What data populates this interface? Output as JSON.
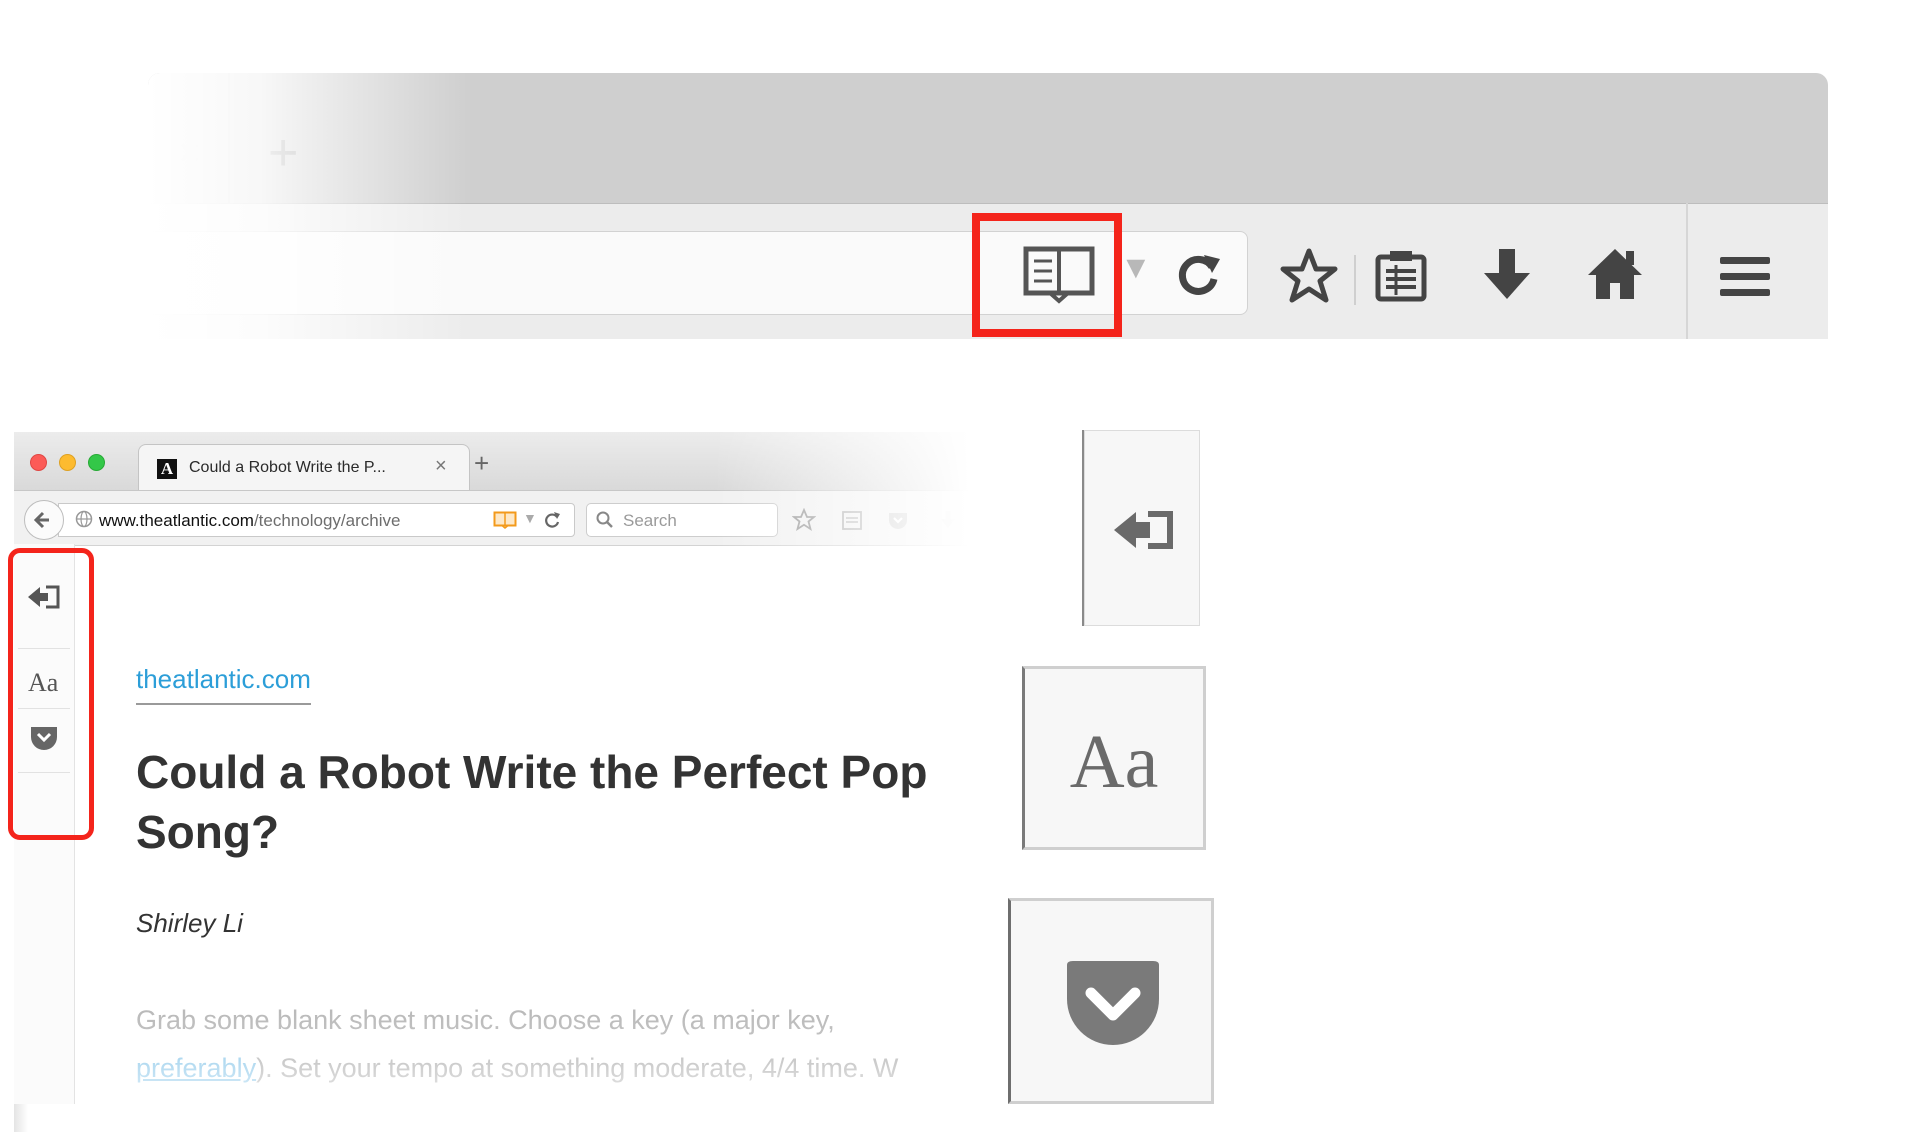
{
  "zoom_toolbar": {
    "tab_close_glyph": "×",
    "new_tab_glyph": "+",
    "icons": [
      "reader-view-icon",
      "dropmarker-icon",
      "reload-icon",
      "bookmark-star-icon",
      "reading-list-icon",
      "download-arrow-icon",
      "home-icon",
      "hamburger-menu-icon"
    ],
    "highlight_color": "#f4241b"
  },
  "window": {
    "tab": {
      "favicon_letter": "A",
      "title": "Could a Robot Write the P...",
      "close_glyph": "×"
    },
    "new_tab_glyph": "+",
    "url": {
      "domain": "www.theatlantic.com",
      "path": "/technology/archive"
    },
    "search": {
      "placeholder": "Search"
    }
  },
  "reader_sidebar": {
    "type_controls_label": "Aa",
    "icons": [
      "close-reader-icon",
      "pocket-icon"
    ]
  },
  "article": {
    "domain": "theatlantic.com",
    "title": "Could a Robot Write the Perfect Pop Song?",
    "author": "Shirley Li",
    "body_line1": "Grab some blank sheet music. Choose a key (a major key,",
    "body_link": "preferably",
    "body_line2_rest": "). Set your tempo at something moderate, 4/4 time. W"
  },
  "detail_panels": {
    "aa_label": "Aa"
  },
  "colors": {
    "highlight": "#f4241b",
    "link": "#2c9ed8",
    "toolbar_bg": "#ececec",
    "tabstrip_bg": "#cfcfcf"
  }
}
